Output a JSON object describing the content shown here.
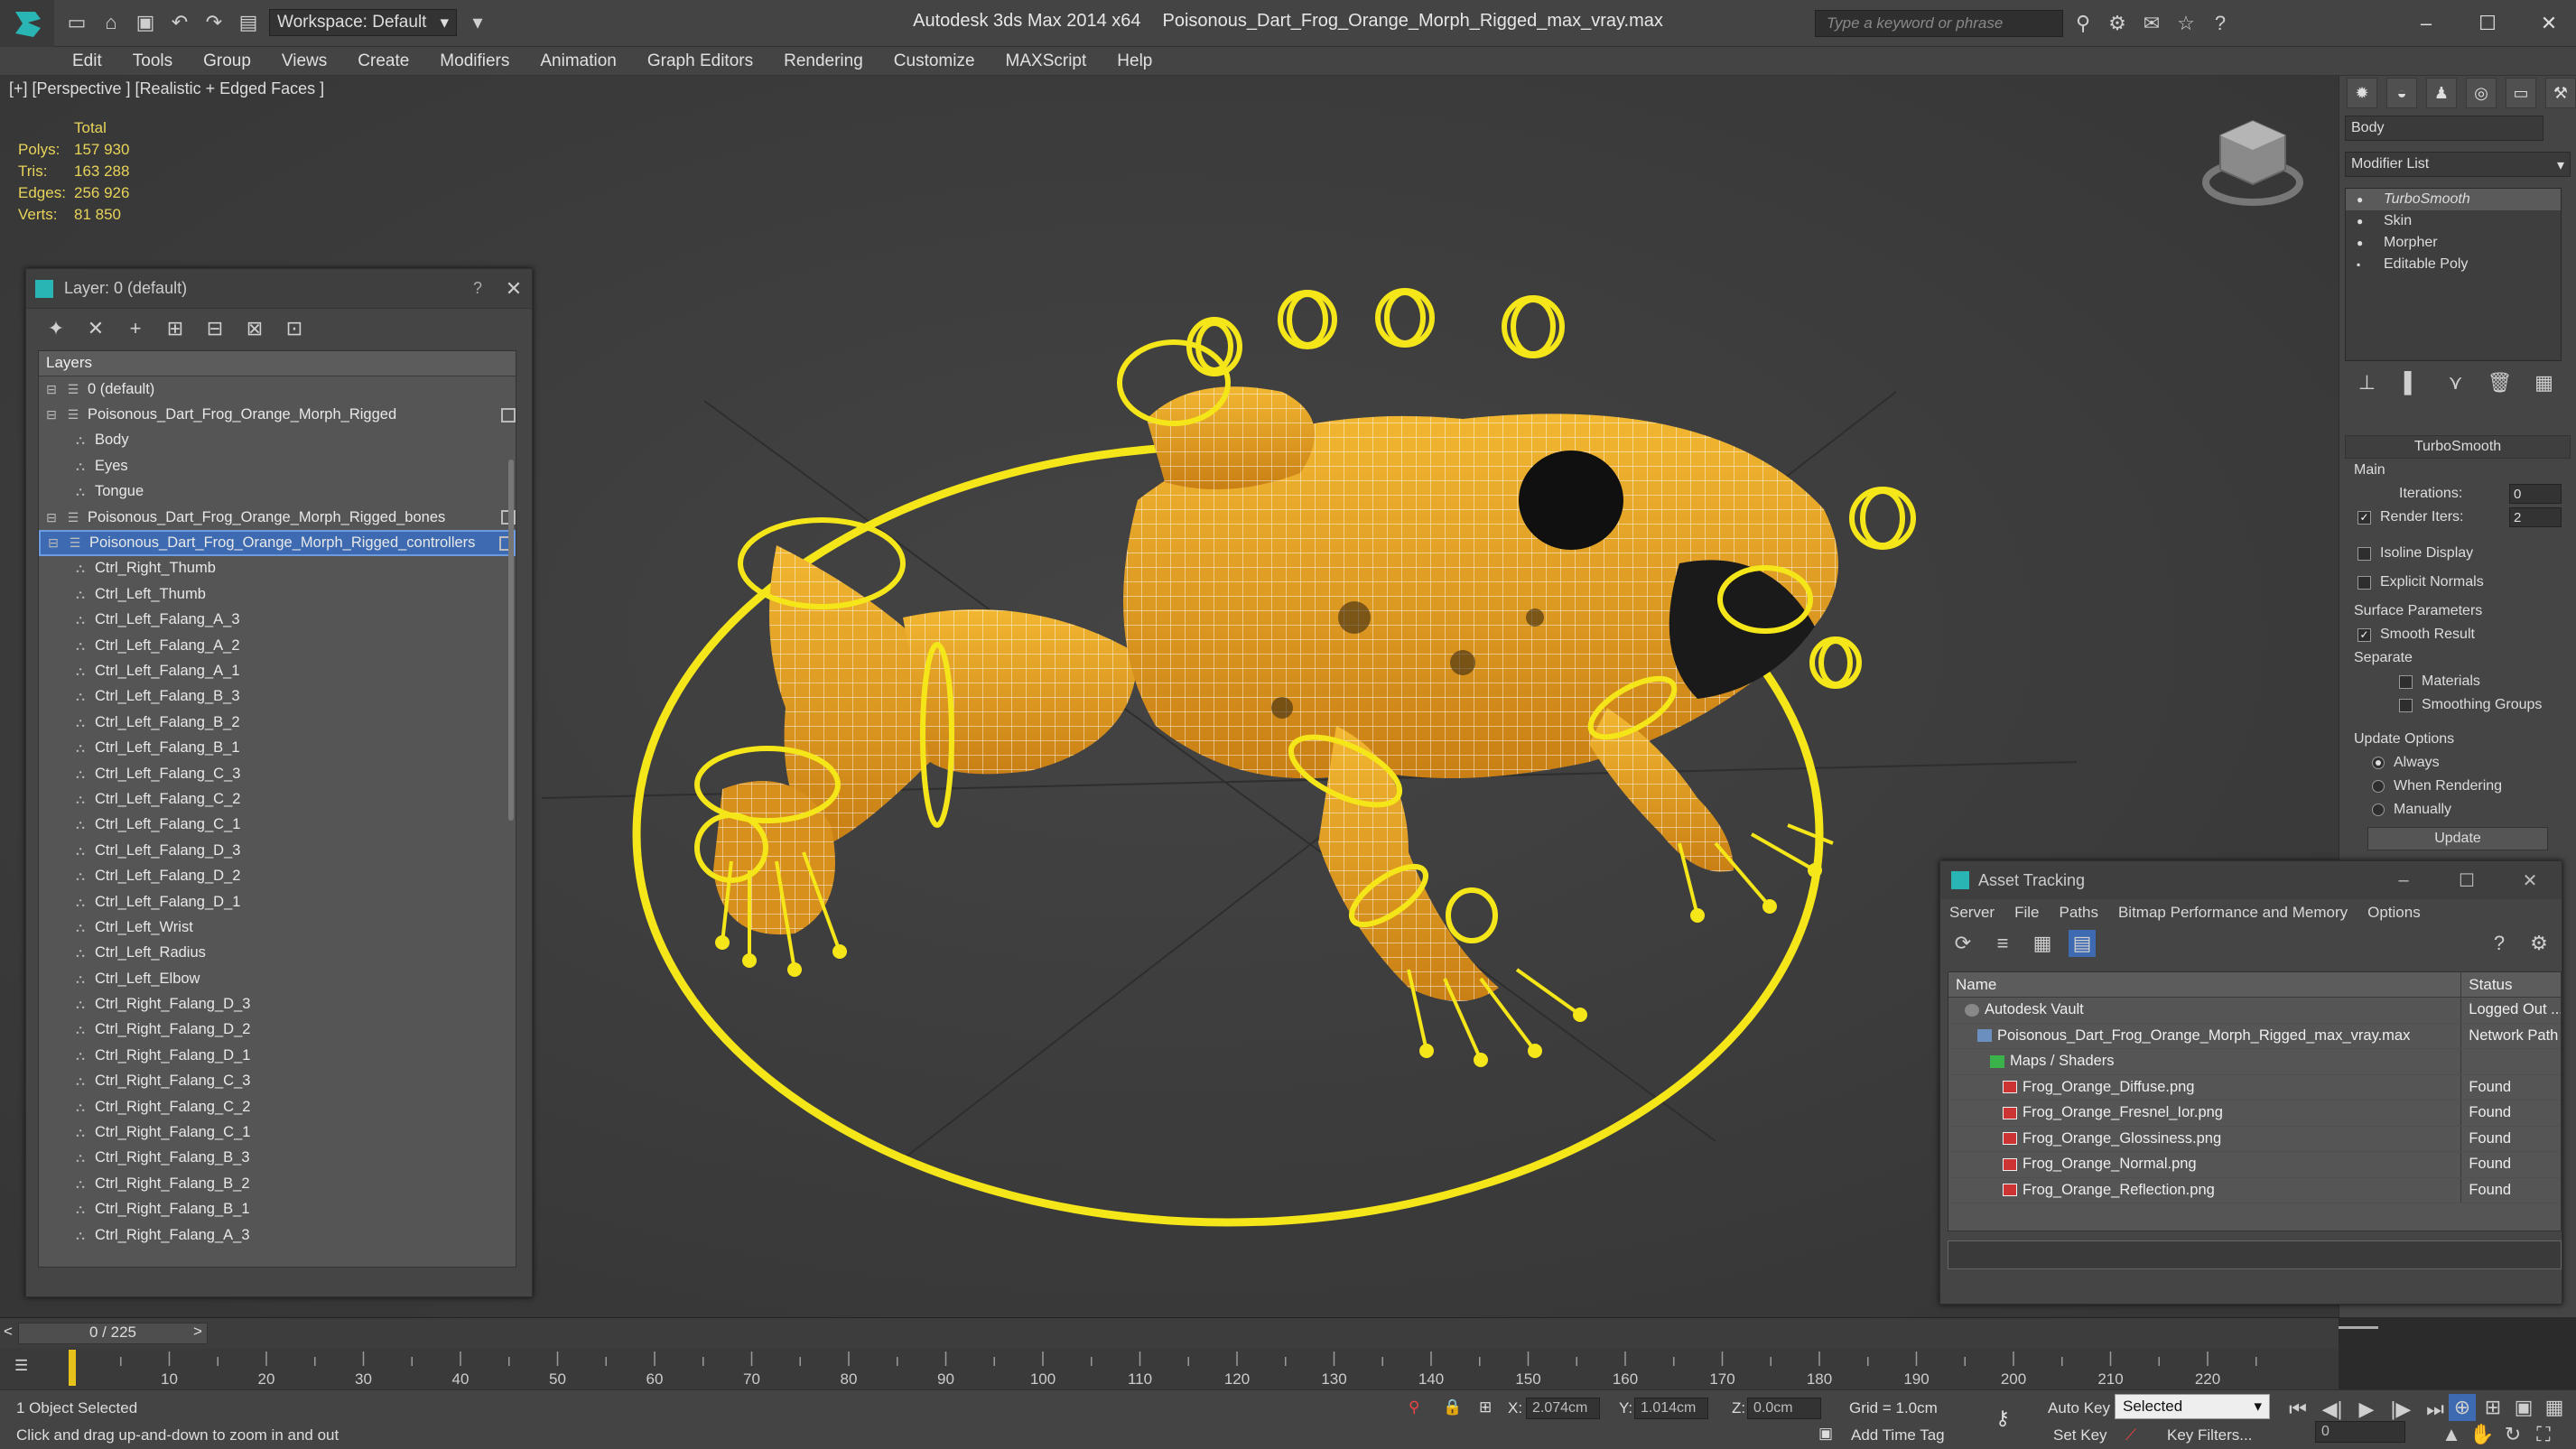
{
  "titlebar": {
    "workspace": "Workspace: Default",
    "app": "Autodesk 3ds Max  2014 x64",
    "file": "Poisonous_Dart_Frog_Orange_Morph_Rigged_max_vray.max",
    "search_placeholder": "Type a keyword or phrase"
  },
  "menu": [
    "Edit",
    "Tools",
    "Group",
    "Views",
    "Create",
    "Modifiers",
    "Animation",
    "Graph Editors",
    "Rendering",
    "Customize",
    "MAXScript",
    "Help"
  ],
  "viewport": {
    "label": "[+] [Perspective ] [Realistic + Edged Faces ]",
    "stats": {
      "total": "Total",
      "rows": [
        {
          "k": "Polys:",
          "v": "157 930"
        },
        {
          "k": "Tris:",
          "v": "163 288"
        },
        {
          "k": "Edges:",
          "v": "256 926"
        },
        {
          "k": "Verts:",
          "v": "81 850"
        }
      ]
    }
  },
  "layer_panel": {
    "title": "Layer: 0 (default)",
    "help": "?",
    "header": "Layers",
    "rows": [
      {
        "label": "0 (default)",
        "indent": 1,
        "type": "layer"
      },
      {
        "label": "Poisonous_Dart_Frog_Orange_Morph_Rigged",
        "indent": 1,
        "type": "layer"
      },
      {
        "label": "Body",
        "indent": 2,
        "type": "obj"
      },
      {
        "label": "Eyes",
        "indent": 2,
        "type": "obj"
      },
      {
        "label": "Tongue",
        "indent": 2,
        "type": "obj"
      },
      {
        "label": "Poisonous_Dart_Frog_Orange_Morph_Rigged_bones",
        "indent": 1,
        "type": "layer"
      },
      {
        "label": "Poisonous_Dart_Frog_Orange_Morph_Rigged_controllers",
        "indent": 1,
        "type": "layer",
        "selected": true
      },
      {
        "label": "Ctrl_Right_Thumb",
        "indent": 3,
        "type": "obj"
      },
      {
        "label": "Ctrl_Left_Thumb",
        "indent": 3,
        "type": "obj"
      },
      {
        "label": "Ctrl_Left_Falang_A_3",
        "indent": 3,
        "type": "obj"
      },
      {
        "label": "Ctrl_Left_Falang_A_2",
        "indent": 3,
        "type": "obj"
      },
      {
        "label": "Ctrl_Left_Falang_A_1",
        "indent": 3,
        "type": "obj"
      },
      {
        "label": "Ctrl_Left_Falang_B_3",
        "indent": 3,
        "type": "obj"
      },
      {
        "label": "Ctrl_Left_Falang_B_2",
        "indent": 3,
        "type": "obj"
      },
      {
        "label": "Ctrl_Left_Falang_B_1",
        "indent": 3,
        "type": "obj"
      },
      {
        "label": "Ctrl_Left_Falang_C_3",
        "indent": 3,
        "type": "obj"
      },
      {
        "label": "Ctrl_Left_Falang_C_2",
        "indent": 3,
        "type": "obj"
      },
      {
        "label": "Ctrl_Left_Falang_C_1",
        "indent": 3,
        "type": "obj"
      },
      {
        "label": "Ctrl_Left_Falang_D_3",
        "indent": 3,
        "type": "obj"
      },
      {
        "label": "Ctrl_Left_Falang_D_2",
        "indent": 3,
        "type": "obj"
      },
      {
        "label": "Ctrl_Left_Falang_D_1",
        "indent": 3,
        "type": "obj"
      },
      {
        "label": "Ctrl_Left_Wrist",
        "indent": 3,
        "type": "obj"
      },
      {
        "label": "Ctrl_Left_Radius",
        "indent": 3,
        "type": "obj"
      },
      {
        "label": "Ctrl_Left_Elbow",
        "indent": 3,
        "type": "obj"
      },
      {
        "label": "Ctrl_Right_Falang_D_3",
        "indent": 3,
        "type": "obj"
      },
      {
        "label": "Ctrl_Right_Falang_D_2",
        "indent": 3,
        "type": "obj"
      },
      {
        "label": "Ctrl_Right_Falang_D_1",
        "indent": 3,
        "type": "obj"
      },
      {
        "label": "Ctrl_Right_Falang_C_3",
        "indent": 3,
        "type": "obj"
      },
      {
        "label": "Ctrl_Right_Falang_C_2",
        "indent": 3,
        "type": "obj"
      },
      {
        "label": "Ctrl_Right_Falang_C_1",
        "indent": 3,
        "type": "obj"
      },
      {
        "label": "Ctrl_Right_Falang_B_3",
        "indent": 3,
        "type": "obj"
      },
      {
        "label": "Ctrl_Right_Falang_B_2",
        "indent": 3,
        "type": "obj"
      },
      {
        "label": "Ctrl_Right_Falang_B_1",
        "indent": 3,
        "type": "obj"
      },
      {
        "label": "Ctrl_Right_Falang_A_3",
        "indent": 3,
        "type": "obj"
      }
    ]
  },
  "command_panel": {
    "object_name": "Body",
    "modifier_list": "Modifier List",
    "stack": [
      "TurboSmooth",
      "Skin",
      "Morpher",
      "Editable Poly"
    ],
    "turbosmooth": {
      "title": "TurboSmooth",
      "main": "Main",
      "iterations_label": "Iterations:",
      "iterations": "0",
      "render_iters_label": "Render Iters:",
      "render_iters": "2",
      "isoline": "Isoline Display",
      "explicit": "Explicit Normals",
      "surface": "Surface Parameters",
      "smooth": "Smooth Result",
      "separate": "Separate",
      "materials": "Materials",
      "smoothing": "Smoothing Groups",
      "update_options": "Update Options",
      "always": "Always",
      "when_rendering": "When Rendering",
      "manually": "Manually",
      "update": "Update"
    }
  },
  "asset_tracking": {
    "title": "Asset Tracking",
    "menu": [
      "Server",
      "File",
      "Paths",
      "Bitmap Performance and Memory",
      "Options"
    ],
    "col_name": "Name",
    "col_status": "Status",
    "rows": [
      {
        "name": "Autodesk Vault",
        "status": "Logged Out ...",
        "indent": 1,
        "icon": "vault"
      },
      {
        "name": "Poisonous_Dart_Frog_Orange_Morph_Rigged_max_vray.max",
        "status": "Network Path",
        "indent": 2,
        "icon": "max"
      },
      {
        "name": "Maps / Shaders",
        "status": "",
        "indent": 3,
        "icon": "maps"
      },
      {
        "name": "Frog_Orange_Diffuse.png",
        "status": "Found",
        "indent": 4,
        "icon": "png"
      },
      {
        "name": "Frog_Orange_Fresnel_Ior.png",
        "status": "Found",
        "indent": 4,
        "icon": "png"
      },
      {
        "name": "Frog_Orange_Glossiness.png",
        "status": "Found",
        "indent": 4,
        "icon": "png"
      },
      {
        "name": "Frog_Orange_Normal.png",
        "status": "Found",
        "indent": 4,
        "icon": "png"
      },
      {
        "name": "Frog_Orange_Reflection.png",
        "status": "Found",
        "indent": 4,
        "icon": "png"
      }
    ]
  },
  "timeline": {
    "frame": "0 / 225",
    "ticks": [
      "10",
      "20",
      "30",
      "40",
      "50",
      "60",
      "70",
      "80",
      "90",
      "100",
      "110",
      "120",
      "130",
      "140",
      "150",
      "160",
      "170",
      "180",
      "190",
      "200",
      "210",
      "220"
    ]
  },
  "status": {
    "selected": "1 Object Selected",
    "hint": "Click and drag up-and-down to zoom in and out",
    "x_label": "X:",
    "x": "2.074cm",
    "y_label": "Y:",
    "y": "1.014cm",
    "z_label": "Z:",
    "z": "0.0cm",
    "grid": "Grid = 1.0cm",
    "autokey": "Auto Key",
    "setkey": "Set Key",
    "selected_mode": "Selected",
    "key_filters": "Key Filters...",
    "add_time_tag": "Add Time Tag",
    "frame_field": "0"
  },
  "colors": {
    "rig_yellow": "#f5e61a",
    "frog_orange": "#e3a51f",
    "selection_blue": "#3d6ab0"
  }
}
